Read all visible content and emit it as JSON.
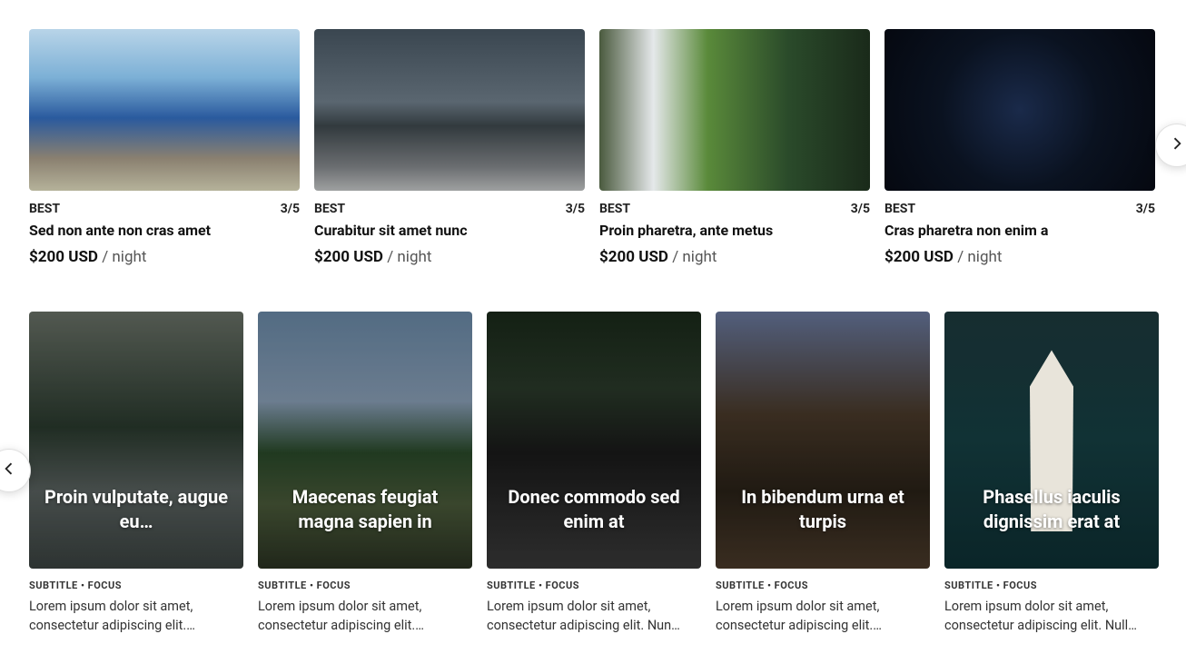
{
  "row1": [
    {
      "badge": "BEST",
      "rating": "3/5",
      "title": "Sed non ante non cras amet",
      "price": "$200 USD",
      "per": "/ night"
    },
    {
      "badge": "BEST",
      "rating": "3/5",
      "title": "Curabitur sit amet nunc",
      "price": "$200 USD",
      "per": "/ night"
    },
    {
      "badge": "BEST",
      "rating": "3/5",
      "title": "Proin pharetra, ante metus",
      "price": "$200 USD",
      "per": "/ night"
    },
    {
      "badge": "BEST",
      "rating": "3/5",
      "title": "Cras pharetra non enim a",
      "price": "$200 USD",
      "per": "/ night"
    }
  ],
  "row2": [
    {
      "overlay": "Proin vulputate, augue eu…",
      "sub": "SUBTITLE • FOCUS",
      "desc": "Lorem ipsum dolor sit amet, consectetur adipiscing elit.…"
    },
    {
      "overlay": "Maecenas feugiat magna sapien in",
      "sub": "SUBTITLE • FOCUS",
      "desc": "Lorem ipsum dolor sit amet, consectetur adipiscing elit.…"
    },
    {
      "overlay": "Donec commodo sed enim at",
      "sub": "SUBTITLE • FOCUS",
      "desc": "Lorem ipsum dolor sit amet, consectetur adipiscing elit. Nun…"
    },
    {
      "overlay": "In bibendum urna et turpis",
      "sub": "SUBTITLE • FOCUS",
      "desc": "Lorem ipsum dolor sit amet, consectetur adipiscing elit.…"
    },
    {
      "overlay": "Phasellus iaculis dignissim erat at",
      "sub": "SUBTITLE • FOCUS",
      "desc": "Lorem ipsum dolor sit amet, consectetur adipiscing elit. Null…"
    }
  ]
}
